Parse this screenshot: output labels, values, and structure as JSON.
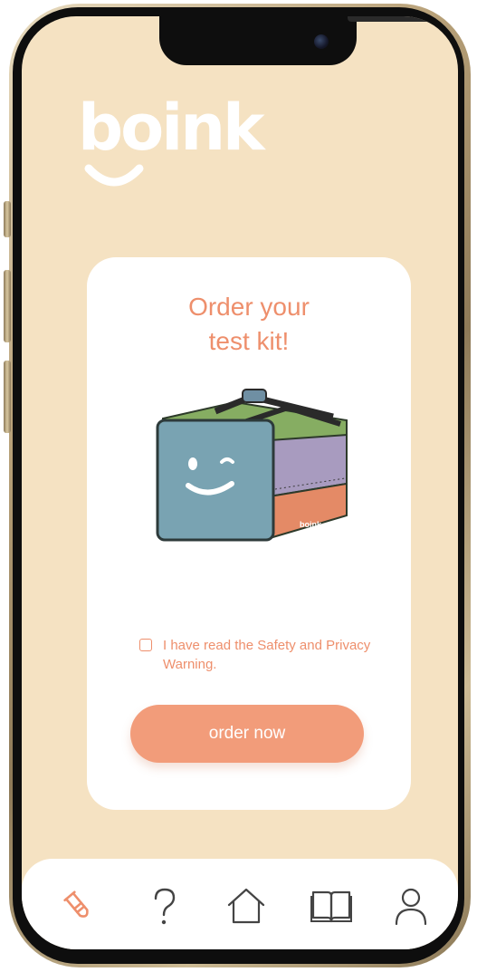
{
  "brand": {
    "logo_text": "boink"
  },
  "card": {
    "title_line1": "Order your",
    "title_line2": "test kit!",
    "kit_label": "boink",
    "consent_text": "I have read the Safety and Privacy Warning.",
    "order_button_label": "order now"
  },
  "nav": {
    "items": [
      {
        "icon": "test-tube-icon",
        "active": true
      },
      {
        "icon": "question-mark-icon",
        "active": false
      },
      {
        "icon": "home-icon",
        "active": false
      },
      {
        "icon": "book-icon",
        "active": false
      },
      {
        "icon": "person-icon",
        "active": false
      }
    ]
  },
  "colors": {
    "background": "#f5e2c2",
    "accent": "#ee8f6c",
    "button": "#f29c7a",
    "icon_inactive": "#444444"
  }
}
